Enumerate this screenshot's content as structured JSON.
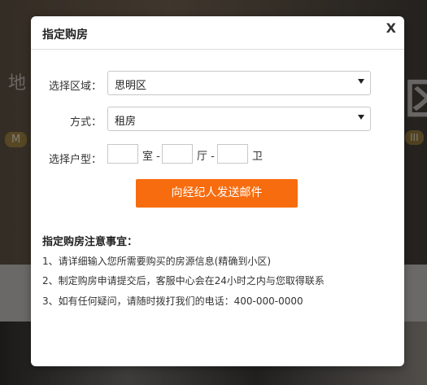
{
  "dialog": {
    "title": "指定购房",
    "close_label": "X"
  },
  "form": {
    "region": {
      "label": "选择区域：",
      "value": "思明区"
    },
    "method": {
      "label": "方式：",
      "value": "租房"
    },
    "layout": {
      "label": "选择户型：",
      "rooms_unit": "室 -",
      "halls_unit": "厅 -",
      "baths_unit": "卫"
    },
    "submit_label": "向经纪人发送邮件"
  },
  "notes": {
    "title": "指定购房注意事宜：",
    "items": [
      "1、请详细输入您所需要购买的房源信息(精确到小区)",
      "2、制定购房申请提交后，客服中心会在24小时之内与您取得联系",
      "3、如有任何疑问，请随时拨打我们的电话：400-000-0000"
    ]
  },
  "background": {
    "left_text": "地",
    "left_pill": "M",
    "right_text": "区",
    "right_pill": "III"
  }
}
